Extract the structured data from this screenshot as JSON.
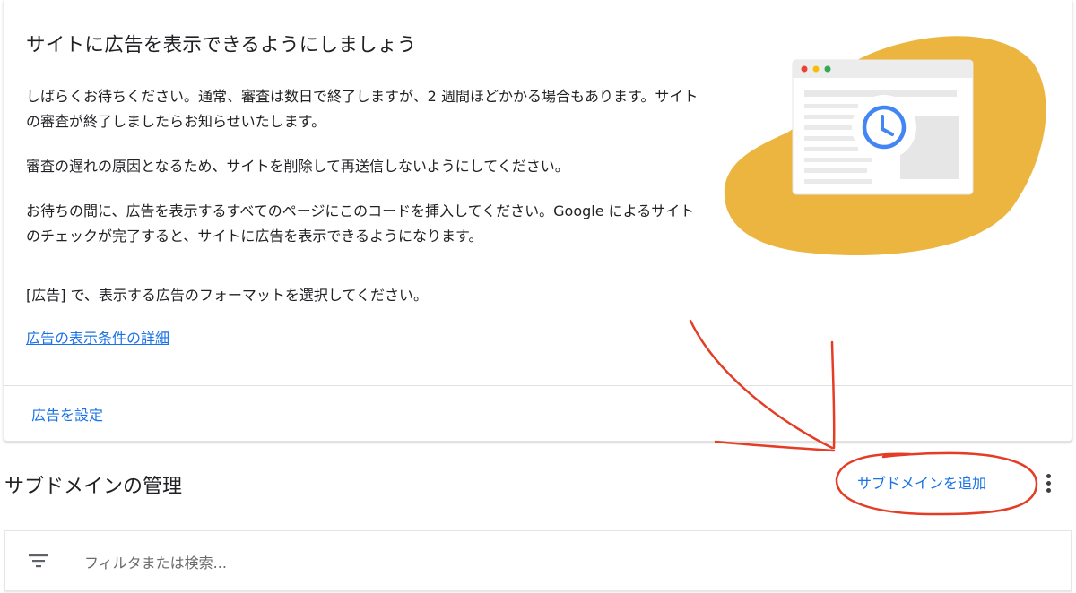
{
  "card": {
    "title": "サイトに広告を表示できるようにしましょう",
    "paragraph1": "しばらくお待ちください。通常、審査は数日で終了しますが、2 週間ほどかかる場合もあります。サイトの審査が終了しましたらお知らせいたします。",
    "paragraph2": "審査の遅れの原因となるため、サイトを削除して再送信しないようにしてください。",
    "paragraph3": "お待ちの間に、広告を表示するすべてのページにこのコードを挿入してください。Google によるサイトのチェックが完了すると、サイトに広告を表示できるようになります。",
    "paragraph4": "[広告] で、表示する広告のフォーマットを選択してください。",
    "help_link": "広告の表示条件の詳細",
    "action_button": "広告を設定"
  },
  "illustration": {
    "blob_color": "#ebb53f",
    "icon": "clock-icon",
    "accent": "#4285f4"
  },
  "subdomains": {
    "title": "サブドメインの管理",
    "add_button": "サブドメインを追加",
    "more_icon": "more-vert-icon"
  },
  "filter": {
    "icon": "filter-icon",
    "placeholder": "フィルタまたは検索..."
  },
  "annotation": {
    "color": "#e53d25"
  }
}
